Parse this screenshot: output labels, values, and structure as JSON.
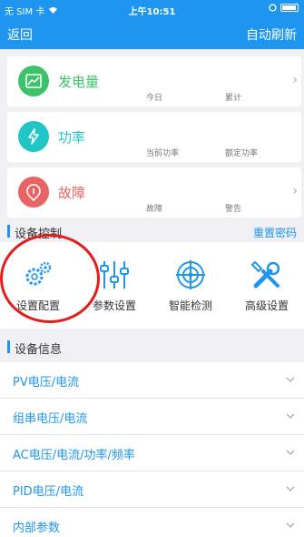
{
  "status_bar": {
    "carrier": "无 SIM 卡",
    "time": "上午10:51"
  },
  "nav": {
    "back_label": "返回",
    "refresh_label": "自动刷新"
  },
  "cards": [
    {
      "title": "发电量",
      "sub1": "今日",
      "sub2": "累计",
      "icon": "chart-icon",
      "color": "#3cc36a"
    },
    {
      "title": "功率",
      "sub1": "当前功率",
      "sub2": "额定功率",
      "icon": "lightning-icon",
      "color": "#20c5c5"
    },
    {
      "title": "故障",
      "sub1": "故障",
      "sub2": "警告",
      "icon": "alert-icon",
      "color": "#e86363"
    }
  ],
  "device_control": {
    "heading": "设备控制",
    "reset_password": "重置密码",
    "items": [
      {
        "label": "设置配置",
        "icon": "gears-icon"
      },
      {
        "label": "参数设置",
        "icon": "sliders-icon"
      },
      {
        "label": "智能检测",
        "icon": "target-icon"
      },
      {
        "label": "高级设置",
        "icon": "tools-icon"
      }
    ]
  },
  "device_info": {
    "heading": "设备信息",
    "rows": [
      {
        "label": "PV电压/电流"
      },
      {
        "label": "组串电压/电流"
      },
      {
        "label": "AC电压/电流/功率/频率"
      },
      {
        "label": "PID电压/电流"
      },
      {
        "label": "内部参数"
      }
    ]
  },
  "colors": {
    "primary": "#1e96f0",
    "highlight_ring": "#e31c1c"
  }
}
